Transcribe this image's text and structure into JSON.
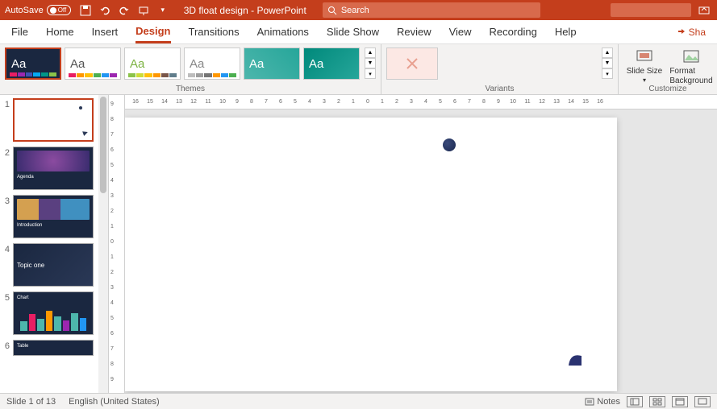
{
  "titlebar": {
    "autosave_label": "AutoSave",
    "autosave_state": "Off",
    "doc_title": "3D float design",
    "app_name": "PowerPoint",
    "search_placeholder": "Search"
  },
  "tabs": {
    "file": "File",
    "home": "Home",
    "insert": "Insert",
    "design": "Design",
    "transitions": "Transitions",
    "animations": "Animations",
    "slideshow": "Slide Show",
    "review": "Review",
    "view": "View",
    "recording": "Recording",
    "help": "Help",
    "share": "Sha"
  },
  "ribbon": {
    "themes_label": "Themes",
    "variants_label": "Variants",
    "customize_label": "Customize",
    "slide_size": "Slide Size",
    "format_bg": "Format Background"
  },
  "slides": [
    {
      "num": "1",
      "title": ""
    },
    {
      "num": "2",
      "title": "Agenda"
    },
    {
      "num": "3",
      "title": "Introduction"
    },
    {
      "num": "4",
      "title": "Topic one"
    },
    {
      "num": "5",
      "title": "Chart"
    },
    {
      "num": "6",
      "title": "Table"
    }
  ],
  "ruler_h": [
    "16",
    "15",
    "14",
    "13",
    "12",
    "11",
    "10",
    "9",
    "8",
    "7",
    "6",
    "5",
    "4",
    "3",
    "2",
    "1",
    "0",
    "1",
    "2",
    "3",
    "4",
    "5",
    "6",
    "7",
    "8",
    "9",
    "10",
    "11",
    "12",
    "13",
    "14",
    "15",
    "16"
  ],
  "ruler_v": [
    "9",
    "8",
    "7",
    "6",
    "5",
    "4",
    "3",
    "2",
    "1",
    "0",
    "1",
    "2",
    "3",
    "4",
    "5",
    "6",
    "7",
    "8",
    "9"
  ],
  "status": {
    "slide_pos": "Slide 1 of 13",
    "language": "English (United States)",
    "notes": "Notes"
  }
}
